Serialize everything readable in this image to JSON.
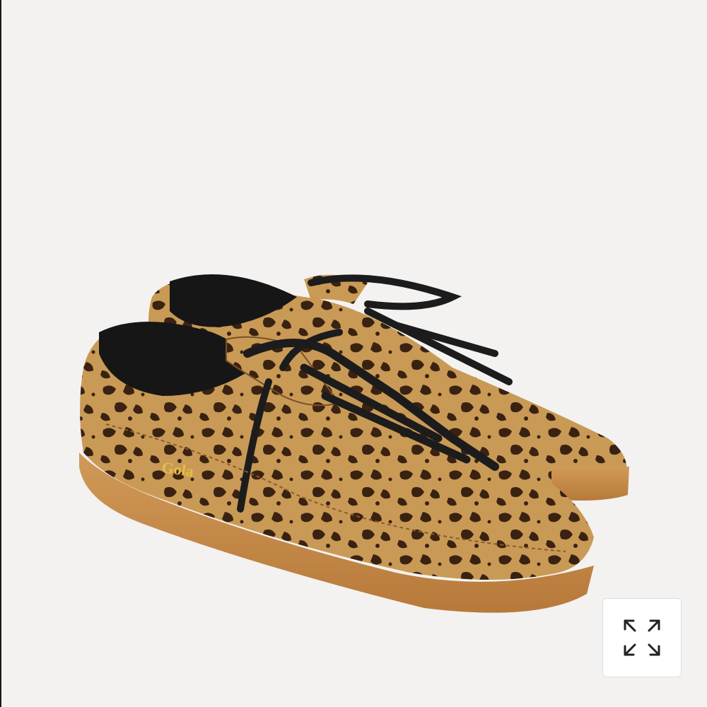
{
  "product_image": {
    "brand_label": "Gola",
    "icon": "leopard-print-sneakers-image",
    "colors": {
      "background": "#f3f2f0",
      "coat": "#c99a55",
      "spots": "#3a2212",
      "sole": "#c98d4a",
      "laces": "#1c1c1c",
      "logo": "#e4bd45"
    }
  },
  "expand_button": {
    "icon": "expand-icon"
  }
}
